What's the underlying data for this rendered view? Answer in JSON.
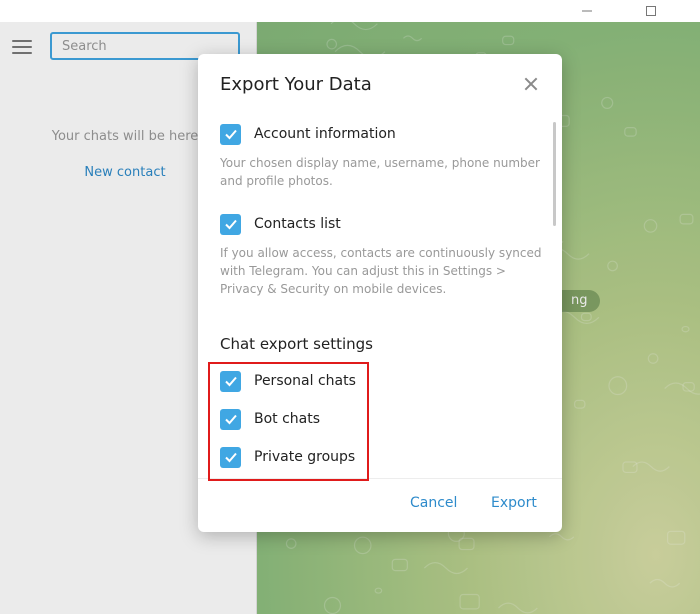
{
  "sidebar": {
    "search_placeholder": "Search",
    "empty_text": "Your chats will be here",
    "new_contact": "New contact"
  },
  "chat": {
    "pill_text": "ng"
  },
  "dialog": {
    "title": "Export Your Data",
    "options": [
      {
        "label": "Account information",
        "checked": true,
        "description": "Your chosen display name, username, phone number and profile photos."
      },
      {
        "label": "Contacts list",
        "checked": true,
        "description": "If you allow access, contacts are continuously synced with Telegram. You can adjust this in Settings > Privacy & Security on mobile devices."
      }
    ],
    "section_title": "Chat export settings",
    "chat_options": [
      {
        "label": "Personal chats",
        "checked": true
      },
      {
        "label": "Bot chats",
        "checked": true
      },
      {
        "label": "Private groups",
        "checked": true
      }
    ],
    "cancel_label": "Cancel",
    "export_label": "Export"
  },
  "colors": {
    "accent": "#40a7e3",
    "link": "#2e8bcb",
    "highlight": "#e01b1b"
  }
}
